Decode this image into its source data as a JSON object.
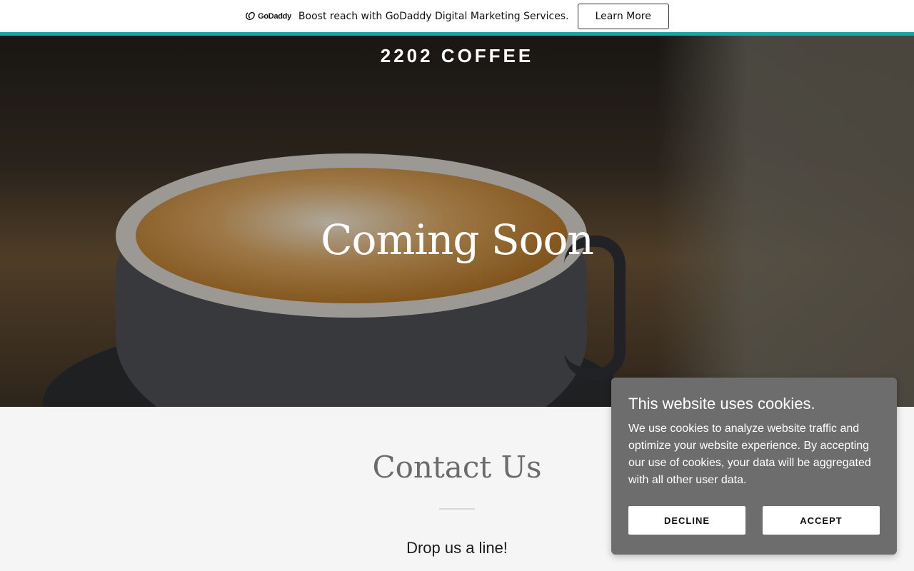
{
  "promo": {
    "logo_text": "GoDaddy",
    "message": "Boost reach with GoDaddy Digital Marketing Services.",
    "cta_label": "Learn More"
  },
  "hero": {
    "brand": "2202 COFFEE",
    "title": "Coming Soon"
  },
  "contact": {
    "title": "Contact Us",
    "subtitle": "Drop us a line!"
  },
  "cookie_banner": {
    "title": "This website uses cookies.",
    "body": "We use cookies to analyze website traffic and optimize your website experience. By accepting our use of cookies, your data will be aggregated with all other user data.",
    "decline_label": "DECLINE",
    "accept_label": "ACCEPT"
  },
  "colors": {
    "accent": "#1aa5a5",
    "cookie_background": "#6d6d6d"
  },
  "icons": {
    "logo": "godaddy-logo-icon"
  }
}
